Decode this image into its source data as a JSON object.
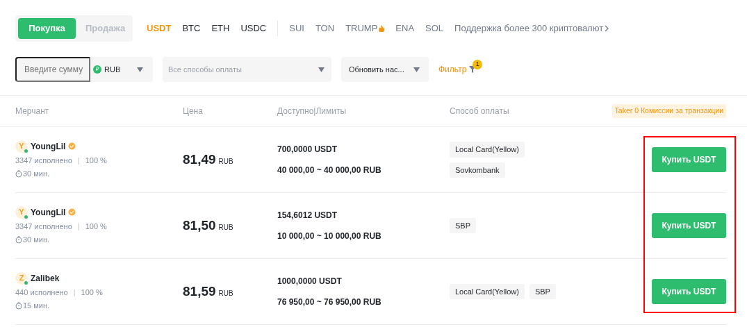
{
  "trade_tabs": [
    {
      "label": "Покупка",
      "selected": true
    },
    {
      "label": "Продажа",
      "selected": false
    }
  ],
  "coins": [
    {
      "label": "USDT",
      "selected": true
    },
    {
      "label": "BTC",
      "selected": false
    },
    {
      "label": "ETH",
      "selected": false
    },
    {
      "label": "USDC",
      "selected": false
    }
  ],
  "more_coins": [
    {
      "label": "SUI",
      "hot": false
    },
    {
      "label": "TON",
      "hot": false
    },
    {
      "label": "TRUMP",
      "hot": true
    },
    {
      "label": "ENA",
      "hot": false
    },
    {
      "label": "SOL",
      "hot": false
    }
  ],
  "more_link": "Поддержка более 300 криптовалют",
  "filters": {
    "amount": {
      "placeholder": "Введите сумму"
    },
    "currency": {
      "symbol": "₽",
      "label": "RUB"
    },
    "payment": {
      "placeholder": "Все способы оплаты"
    },
    "refresh": {
      "label": "Обновить нас..."
    },
    "filter": {
      "label": "Фильтр",
      "count": "1"
    }
  },
  "table": {
    "columns": [
      "Мерчант",
      "Цена",
      "Доступно|Лимиты",
      "Способ оплаты"
    ],
    "fee_note": "Taker 0 Комиссии за транзакции",
    "buttons_highlighted": true,
    "rows": [
      {
        "avatar": "Y",
        "name": "YoungLil",
        "verified": true,
        "online": true,
        "orders": "3347 исполнено",
        "separator": "|",
        "completion": "100 %",
        "time": "30 мин.",
        "price": "81,49",
        "price_currency": "RUB",
        "available": "700,0000 USDT",
        "limits": "40 000,00 ~ 40 000,00 RUB",
        "payments": [
          "Local Card(Yellow)",
          "Sovkombank"
        ],
        "payments_stacked": true,
        "button": "Купить USDT"
      },
      {
        "avatar": "Y",
        "name": "YoungLil",
        "verified": true,
        "online": true,
        "orders": "3347 исполнено",
        "separator": "|",
        "completion": "100 %",
        "time": "30 мин.",
        "price": "81,50",
        "price_currency": "RUB",
        "available": "154,6012 USDT",
        "limits": "10 000,00 ~ 10 000,00 RUB",
        "payments": [
          "SBP"
        ],
        "payments_stacked": false,
        "button": "Купить USDT"
      },
      {
        "avatar": "Z",
        "name": "Zalibek",
        "verified": false,
        "online": true,
        "orders": "440 исполнено",
        "separator": "|",
        "completion": "100 %",
        "time": "15 мин.",
        "price": "81,59",
        "price_currency": "RUB",
        "available": "1000,0000 USDT",
        "limits": "76 950,00 ~ 76 950,00 RUB",
        "payments": [
          "Local Card(Yellow)",
          "SBP"
        ],
        "payments_stacked": false,
        "button": "Купить USDT"
      }
    ]
  }
}
